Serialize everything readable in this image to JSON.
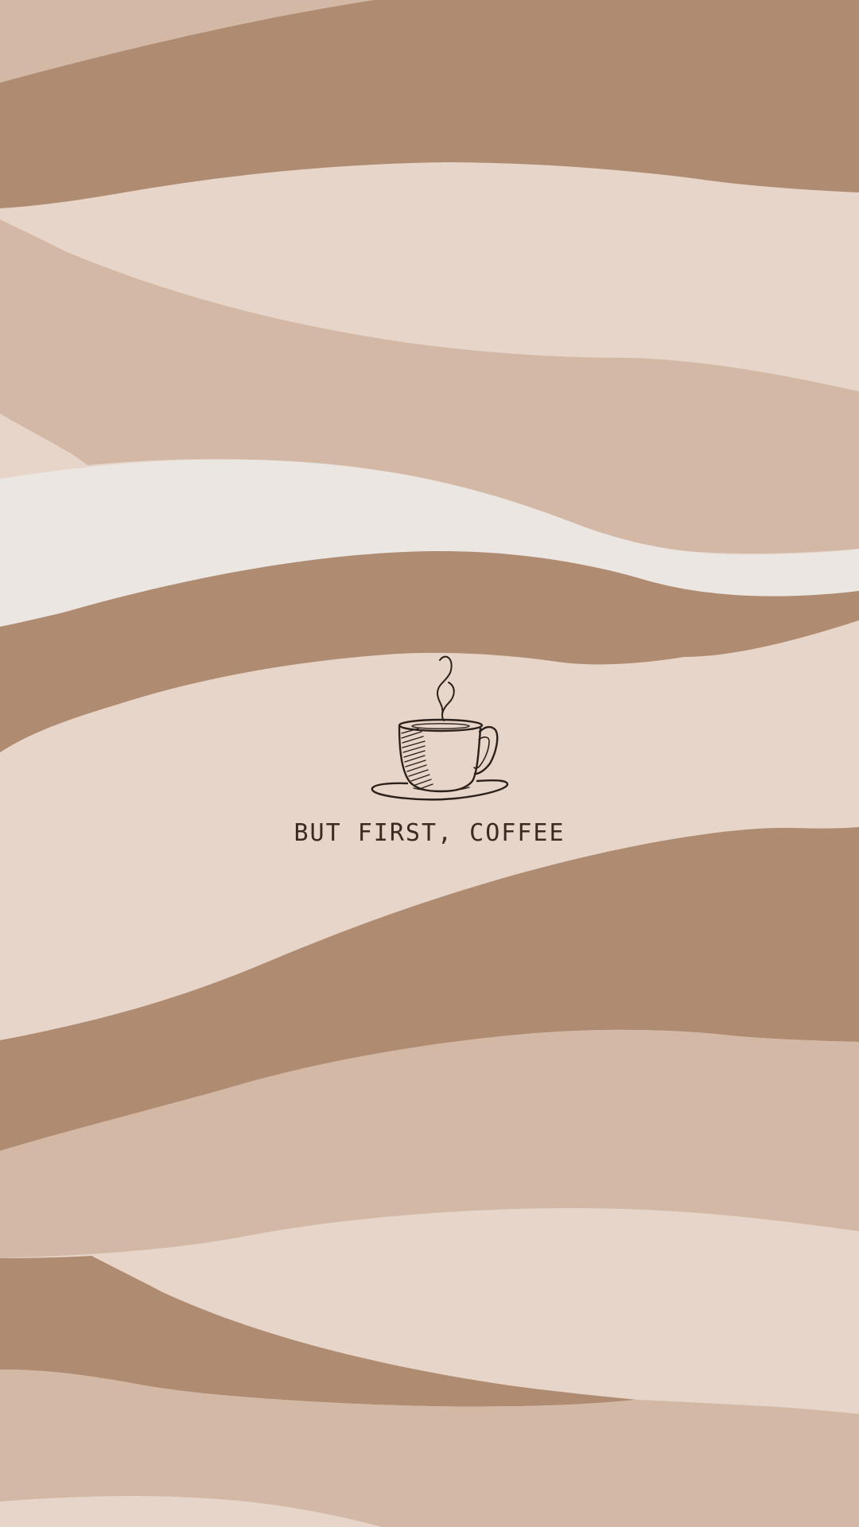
{
  "wallpaper": {
    "tagline": "BUT FIRST, COFFEE",
    "icon": "coffee-cup-icon",
    "colors": {
      "light_beige": "#e6d5c8",
      "sand": "#d2b8a5",
      "mocha": "#af8b71",
      "cream": "#ebe6e1",
      "ink": "#2c201b"
    }
  }
}
